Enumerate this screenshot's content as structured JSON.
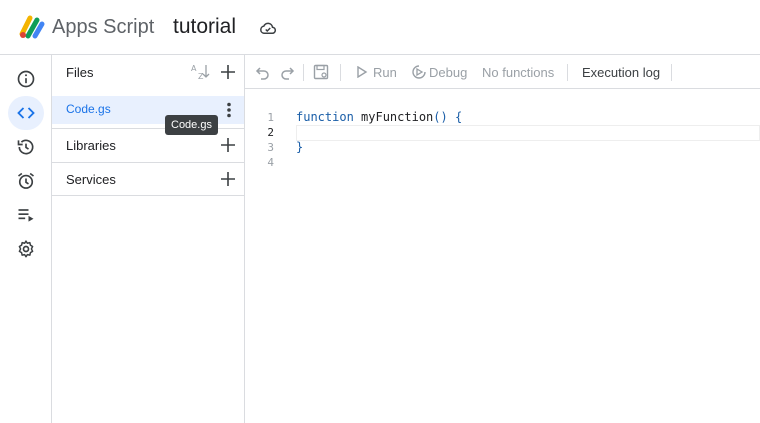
{
  "header": {
    "app_name": "Apps Script",
    "project_title": "tutorial",
    "logo_icon": "apps-script-logo",
    "cloud_icon": "cloud-saved-icon"
  },
  "rail": {
    "items": [
      {
        "name": "overview",
        "icon": "info-icon"
      },
      {
        "name": "editor",
        "icon": "code-icon",
        "active": true
      },
      {
        "name": "project-history",
        "icon": "history-icon"
      },
      {
        "name": "triggers",
        "icon": "alarm-icon"
      },
      {
        "name": "executions",
        "icon": "executions-icon"
      },
      {
        "name": "project-settings",
        "icon": "gear-icon"
      }
    ]
  },
  "files_panel": {
    "files_label": "Files",
    "sort_icon": "sort-az-icon",
    "file_name": "Code.gs",
    "tooltip": "Code.gs",
    "libraries_label": "Libraries",
    "services_label": "Services"
  },
  "toolbar": {
    "run_label": "Run",
    "debug_label": "Debug",
    "function_select": "No functions",
    "execution_log_label": "Execution log"
  },
  "editor": {
    "line_numbers": [
      "1",
      "2",
      "3",
      "4"
    ],
    "code": {
      "keyword": "function",
      "function_name": "myFunction",
      "signature_tail": "() {",
      "closing": "}"
    }
  },
  "colors": {
    "accent": "#1a73e8",
    "active_bg": "#e8f0fe",
    "border": "#dadce0",
    "disabled_text": "#9aa0a6"
  }
}
